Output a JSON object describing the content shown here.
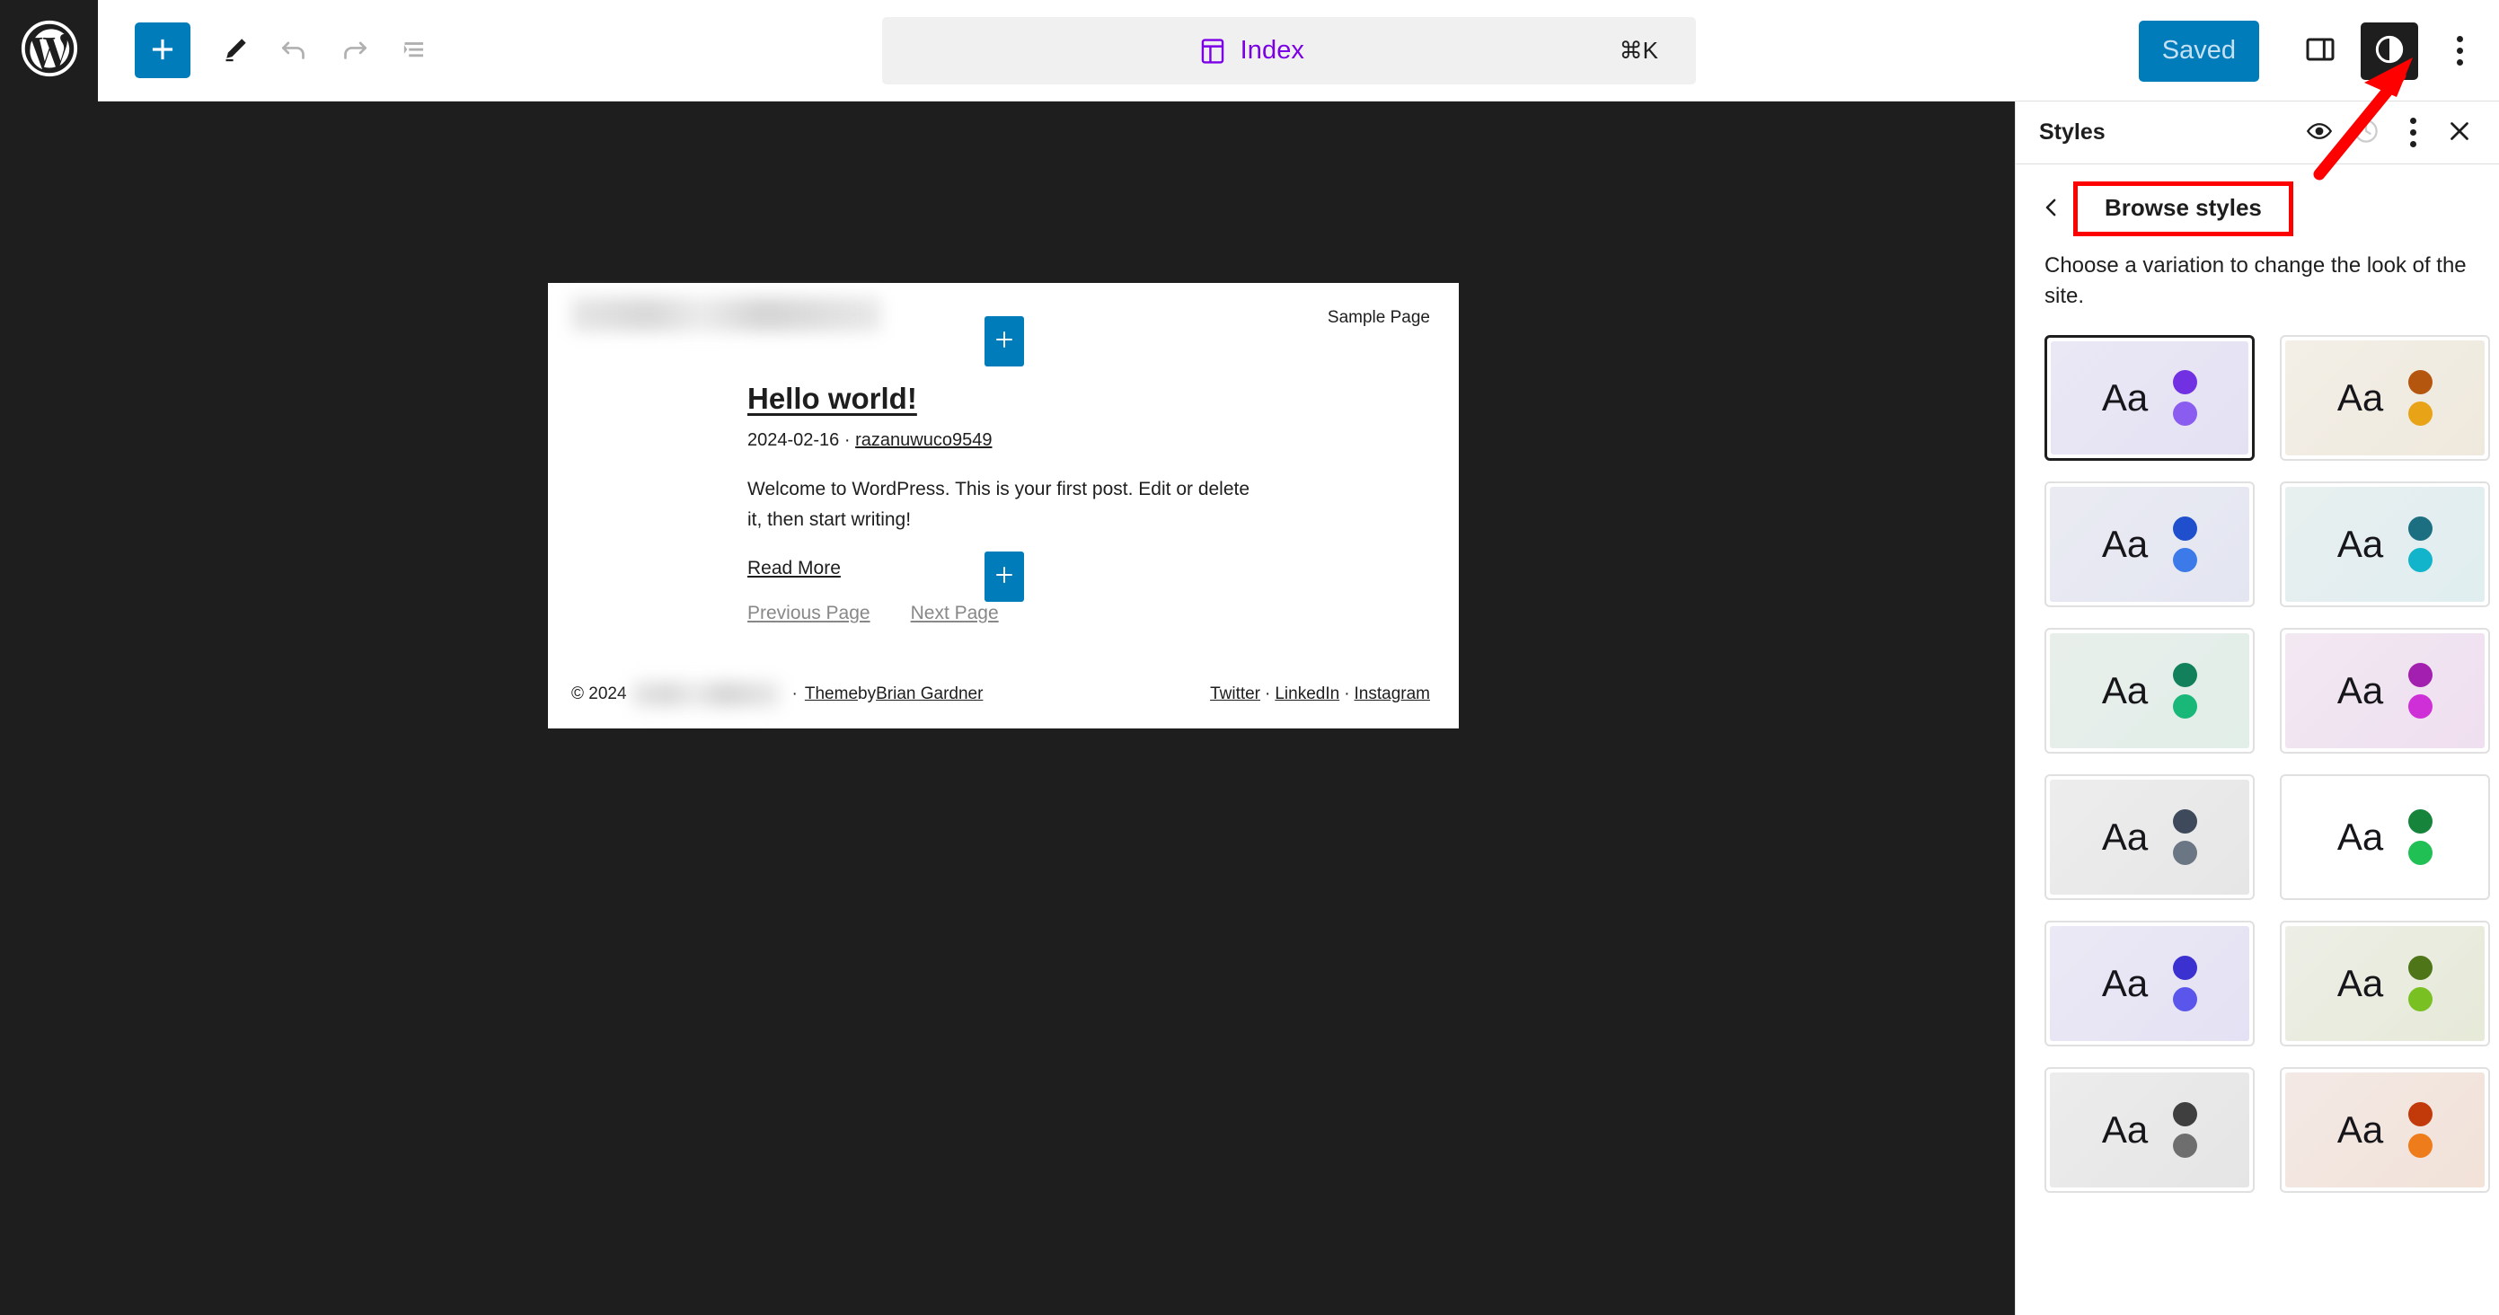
{
  "toolbar": {
    "logo_icon": "wordpress-logo-icon",
    "add_block_icon": "plus-icon",
    "edit_tool_icon": "pencil-icon",
    "undo_icon": "undo-arrow-icon",
    "redo_icon": "redo-arrow-icon",
    "list_view_icon": "document-outline-icon",
    "command_bar": {
      "icon": "index-template-icon",
      "label": "Index",
      "shortcut": "⌘K",
      "accent_color": "#7c00e6"
    },
    "saved_label": "Saved",
    "saved_color": "#007cba",
    "sidebar_toggle_icon": "panel-right-icon",
    "styles_toggle_icon": "contrast-half-circle-icon",
    "more_menu_icon": "kebab-menu-icon"
  },
  "canvas": {
    "nav_sample_page": "Sample Page",
    "inserter_icon": "plus-icon",
    "post": {
      "title": "Hello world!",
      "date": "2024-02-16",
      "meta_separator": "·",
      "author": "razanuwuco9549",
      "excerpt": "Welcome to WordPress. This is your first post. Edit or delete it, then start writing!",
      "read_more": "Read More",
      "previous_page": "Previous Page",
      "next_page": "Next Page"
    },
    "footer": {
      "copyright": "© 2024",
      "separator": "·",
      "theme_by_prefix": "Theme",
      "theme_by_middle": " by ",
      "theme_author": "Brian Gardner",
      "social": [
        {
          "label": "Twitter"
        },
        {
          "label": "LinkedIn"
        },
        {
          "label": "Instagram"
        }
      ],
      "social_separator": "·"
    }
  },
  "styles_panel": {
    "title": "Styles",
    "preview_icon": "eye-icon",
    "revisions_icon": "clock-revisions-icon",
    "more_icon": "kebab-menu-icon",
    "close_icon": "close-x-icon",
    "back_icon": "chevron-left-icon",
    "browse_styles_label": "Browse styles",
    "highlight_color": "#ff0000",
    "description": "Choose a variation to change the look of the site.",
    "sample_text": "Aa",
    "variations": [
      {
        "name": "variation-purple",
        "selected": true,
        "bg_from": "#eae8f5",
        "bg_to": "#e4e1f3",
        "dot_primary": "#7230e3",
        "dot_secondary": "#8b5cf0"
      },
      {
        "name": "variation-amber",
        "selected": false,
        "bg_from": "#f3efe7",
        "bg_to": "#efe9dd",
        "dot_primary": "#b5560f",
        "dot_secondary": "#e8a317"
      },
      {
        "name": "variation-blue",
        "selected": false,
        "bg_from": "#eaebf2",
        "bg_to": "#e3e5f1",
        "dot_primary": "#1f4fcc",
        "dot_secondary": "#3b7ae8"
      },
      {
        "name": "variation-teal",
        "selected": false,
        "bg_from": "#e8efef",
        "bg_to": "#e0eef0",
        "dot_primary": "#1c6f80",
        "dot_secondary": "#12b4cc"
      },
      {
        "name": "variation-green",
        "selected": false,
        "bg_from": "#e8efeb",
        "bg_to": "#e2eee8",
        "dot_primary": "#12805a",
        "dot_secondary": "#19b878"
      },
      {
        "name": "variation-magenta",
        "selected": false,
        "bg_from": "#f2e8f2",
        "bg_to": "#efdff0",
        "dot_primary": "#a31fb0",
        "dot_secondary": "#cf2fd6"
      },
      {
        "name": "variation-slate",
        "selected": false,
        "bg_from": "#ededed",
        "bg_to": "#e6e6e6",
        "dot_primary": "#3e4a5c",
        "dot_secondary": "#6b7685"
      },
      {
        "name": "variation-emerald",
        "selected": false,
        "bg_from": "#e9f1ea",
        "bg_to": "#dcedd f",
        "dot_primary": "#17843c",
        "dot_secondary": "#20c055"
      },
      {
        "name": "variation-indigo",
        "selected": false,
        "bg_from": "#ebe9f5",
        "bg_to": "#e4e1f4",
        "dot_primary": "#3b30d0",
        "dot_secondary": "#5a56ec"
      },
      {
        "name": "variation-olive",
        "selected": false,
        "bg_from": "#edeee6",
        "bg_to": "#e6ead8",
        "dot_primary": "#4e7518",
        "dot_secondary": "#79c022"
      },
      {
        "name": "variation-gray",
        "selected": false,
        "bg_from": "#ececec",
        "bg_to": "#e5e5e5",
        "dot_primary": "#3f3f3f",
        "dot_secondary": "#6e6e6e"
      },
      {
        "name": "variation-orange",
        "selected": false,
        "bg_from": "#f3e9e5",
        "bg_to": "#f2e2d8",
        "dot_primary": "#c23a0a",
        "dot_secondary": "#ef7c1a"
      }
    ]
  },
  "annotation": {
    "arrow_color": "#ff0000",
    "arrow_target": "styles-toggle-button"
  }
}
